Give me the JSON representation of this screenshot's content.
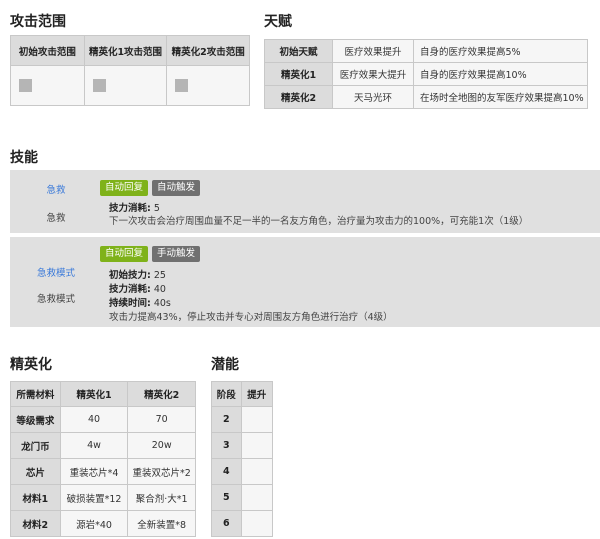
{
  "attack_range": {
    "title": "攻击范围",
    "headers": [
      "初始攻击范围",
      "精英化1攻击范围",
      "精英化2攻击范围"
    ]
  },
  "talent": {
    "title": "天赋",
    "rows": [
      {
        "stage": "初始天赋",
        "name": "医疗效果提升",
        "effect": "自身的医疗效果提高5%"
      },
      {
        "stage": "精英化1",
        "name": "医疗效果大提升",
        "effect": "自身的医疗效果提高10%"
      },
      {
        "stage": "精英化2",
        "name": "天马光环",
        "effect": "在场时全地图的友军医疗效果提高10%"
      }
    ]
  },
  "skills": {
    "title": "技能",
    "list": [
      {
        "link": "急救",
        "name": "急救",
        "recovery": "自动回复",
        "trigger": "自动触发",
        "cost_label": "技力消耗:",
        "cost_value": "5",
        "description": "下一次攻击会治疗周围血量不足一半的一名友方角色，治疗量为攻击力的100%，可充能1次（1级）"
      },
      {
        "link": "急救模式",
        "name": "急救模式",
        "recovery": "自动回复",
        "trigger": "手动触发",
        "init_label": "初始技力:",
        "init_value": "25",
        "cost_label": "技力消耗:",
        "cost_value": "40",
        "duration_label": "持续时间:",
        "duration_value": "40s",
        "description": "攻击力提高43%，停止攻击并专心对周围友方角色进行治疗（4级）"
      }
    ]
  },
  "elite": {
    "title": "精英化",
    "headers": [
      "所需材料",
      "精英化1",
      "精英化2"
    ],
    "rows": [
      {
        "label": "等级需求",
        "e1": "40",
        "e2": "70"
      },
      {
        "label": "龙门币",
        "e1": "4w",
        "e2": "20w"
      },
      {
        "label": "芯片",
        "e1": "重装芯片*4",
        "e2": "重装双芯片*2"
      },
      {
        "label": "材料1",
        "e1": "破损装置*12",
        "e2": "聚合剂·大*1"
      },
      {
        "label": "材料2",
        "e1": "源岩*40",
        "e2": "全新装置*8"
      }
    ]
  },
  "potential": {
    "title": "潜能",
    "headers": [
      "阶段",
      "提升"
    ],
    "rows": [
      {
        "stage": "2",
        "boost": ""
      },
      {
        "stage": "3",
        "boost": ""
      },
      {
        "stage": "4",
        "boost": ""
      },
      {
        "stage": "5",
        "boost": ""
      },
      {
        "stage": "6",
        "boost": ""
      }
    ]
  }
}
